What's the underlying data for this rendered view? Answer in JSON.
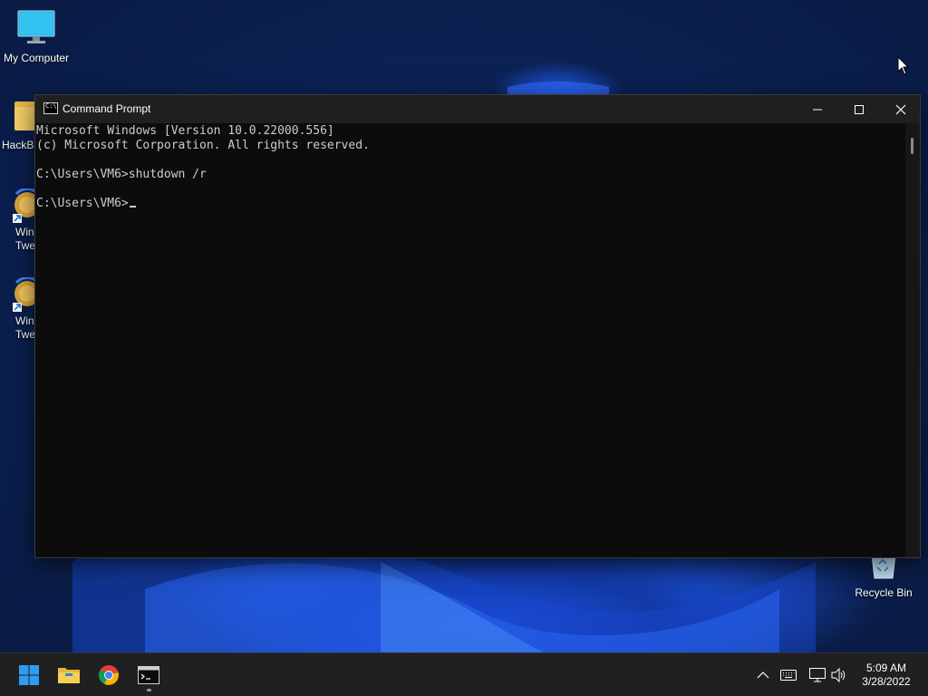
{
  "desktop": {
    "icons": [
      {
        "label": "My Computer",
        "icon": "monitor-icon"
      },
      {
        "label": "HackB",
        "icon": "folder-icon"
      },
      {
        "label": "Win\nTwe",
        "icon": "wintweaker-icon"
      },
      {
        "label": "Win\nTwe",
        "icon": "wintweaker-icon"
      },
      {
        "label": "Recycle Bin",
        "icon": "recycle-bin-icon"
      }
    ]
  },
  "window": {
    "title": "Command Prompt",
    "icon": "cmd-icon",
    "controls": {
      "minimize": "minimize-icon",
      "maximize": "maximize-icon",
      "close": "close-icon"
    },
    "console_lines": [
      "Microsoft Windows [Version 10.0.22000.556]",
      "(c) Microsoft Corporation. All rights reserved.",
      "",
      "C:\\Users\\VM6>shutdown /r",
      "",
      "C:\\Users\\VM6>"
    ]
  },
  "taskbar": {
    "apps": [
      {
        "name": "Start",
        "icon": "windows-start-icon"
      },
      {
        "name": "File Explorer",
        "icon": "file-explorer-icon"
      },
      {
        "name": "Google Chrome",
        "icon": "chrome-icon"
      },
      {
        "name": "Command Prompt",
        "icon": "cmd-icon"
      }
    ],
    "tray": {
      "chevron": "^",
      "icons": [
        "keyboard-icon",
        "network-icon",
        "volume-icon"
      ]
    },
    "clock": {
      "time": "5:09 AM",
      "date": "3/28/2022"
    }
  },
  "colors": {
    "console_bg": "#0c0c0c",
    "console_fg": "#cccccc",
    "titlebar_bg": "#1f1f1f",
    "taskbar_bg": "#202020",
    "accent": "#0078d4"
  }
}
